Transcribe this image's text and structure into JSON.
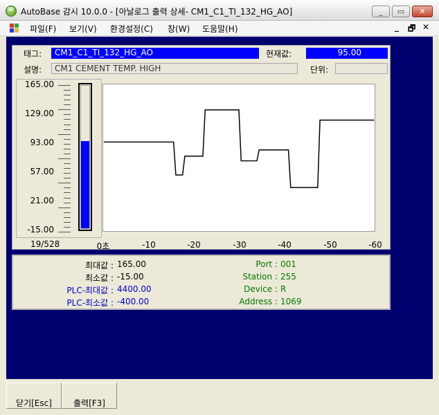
{
  "window": {
    "title": "AutoBase 감시 10.0.0 - [아날로그 출력 상세- CM1_C1_TI_132_HG_AO]",
    "minimize": "_",
    "restore": "▭",
    "close": "✕"
  },
  "menu": {
    "items": [
      "파일(F)",
      "보기(V)",
      "환경설정(C)",
      "창(W)",
      "도움말(H)"
    ],
    "mdi_minimize": "_",
    "mdi_restore": "🗗",
    "mdi_close": "✕"
  },
  "tag": {
    "tag_label": "태그:",
    "tag_value": "CM1_C1_TI_132_HG_AO",
    "current_label": "현재값:",
    "current_value": "95.00",
    "desc_label": "설명:",
    "desc_value": "CM1 CEMENT TEMP. HIGH",
    "unit_label": "단위:",
    "unit_value": ""
  },
  "gauge": {
    "y_labels": [
      "165.00",
      "129.00",
      "93.00",
      "57.00",
      "21.00",
      "-15.00"
    ],
    "min": -15,
    "max": 165,
    "value": 95,
    "count": "19/528"
  },
  "chart_data": {
    "type": "line",
    "x_tick_labels": [
      "0초",
      "-10",
      "-20",
      "-30",
      "-40",
      "-50",
      "-60"
    ],
    "xlim": [
      0,
      -60
    ],
    "ylim": [
      -15,
      165
    ],
    "grid": false,
    "x": [
      0,
      -15.5,
      -16.0,
      -17.5,
      -18.0,
      -22.0,
      -22.5,
      -30.0,
      -30.5,
      -34.0,
      -34.5,
      -41.0,
      -41.5,
      -47.5,
      -48.0,
      -60.0
    ],
    "y": [
      95,
      95,
      53,
      53,
      77,
      77,
      136,
      136,
      71,
      71,
      85,
      85,
      37,
      37,
      123,
      123
    ]
  },
  "info": {
    "max_label": "최대값 :",
    "max_value": "165.00",
    "min_label": "최소값 :",
    "min_value": "-15.00",
    "plc_max_label": "PLC-최대값 :",
    "plc_max_value": "4400.00",
    "plc_min_label": "PLC-최소값 :",
    "plc_min_value": "-400.00",
    "port_label": "Port :",
    "port_value": "001",
    "station_label": "Station :",
    "station_value": "255",
    "device_label": "Device :",
    "device_value": "R",
    "address_label": "Address :",
    "address_value": "1069"
  },
  "buttons": {
    "close": "닫기[Esc]",
    "print": "출력[F3]"
  },
  "colors": {
    "navy": "#00006f",
    "blue": "#0000ff",
    "green_text": "#007800",
    "blue_text": "#0000c8"
  }
}
